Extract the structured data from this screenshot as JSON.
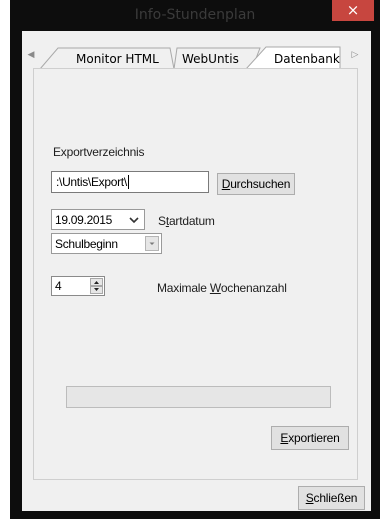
{
  "window": {
    "title": "Info-Stundenplan",
    "close_glyph": "×"
  },
  "tabs": {
    "scroll_left_glyph": "◀",
    "scroll_right_glyph": "▷",
    "items": [
      {
        "label": "Monitor HTML",
        "selected": false
      },
      {
        "label": "WebUntis",
        "selected": false
      },
      {
        "label": "Datenbank",
        "selected": true
      }
    ]
  },
  "export": {
    "directory_label": "Exportverzeichnis",
    "directory_value": ":\\Untis\\Export\\",
    "browse_pre": "",
    "browse_accel": "D",
    "browse_post": "urchsuchen"
  },
  "start": {
    "date_value": "19.09.2015",
    "label_pre": "S",
    "label_accel": "t",
    "label_post": "artdatum",
    "mode_value": "Schulbeginn"
  },
  "weeks": {
    "value": "4",
    "label_pre": "Maximale ",
    "label_accel": "W",
    "label_post": "ochenanzahl"
  },
  "progress": {
    "value_fraction": 0
  },
  "actions": {
    "export_accel": "E",
    "export_post": "xportieren",
    "close_accel": "S",
    "close_post": "chließen"
  }
}
